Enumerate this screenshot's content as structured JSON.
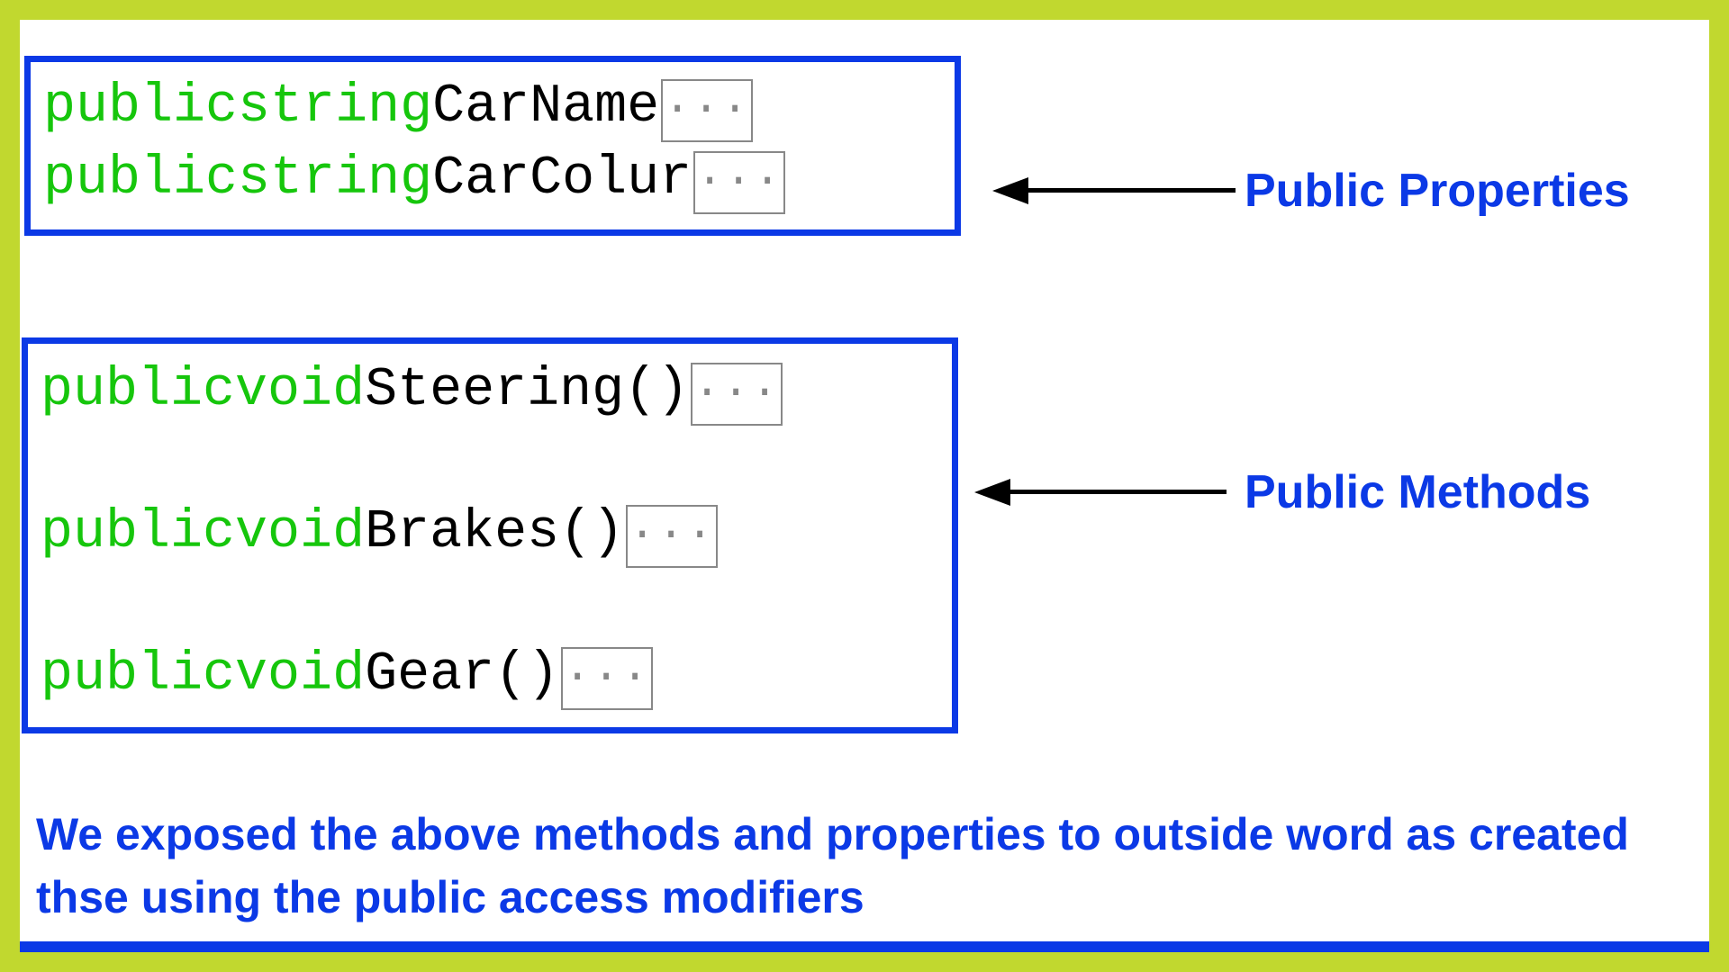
{
  "properties_box": {
    "lines": [
      {
        "modifier": "public ",
        "type": "string ",
        "name": "CarName"
      },
      {
        "modifier": "public ",
        "type": "string ",
        "name": "CarColur"
      }
    ]
  },
  "methods_box": {
    "lines": [
      {
        "modifier": "public ",
        "type": "void ",
        "name": "Steering()"
      },
      {
        "modifier": "public ",
        "type": "void ",
        "name": "Brakes()"
      },
      {
        "modifier": "public ",
        "type": "void ",
        "name": "Gear()"
      }
    ]
  },
  "labels": {
    "properties": "Public Properties",
    "methods": "Public Methods"
  },
  "collapse": "...",
  "footer": "We exposed the above methods and properties to outside word as created thse using the public access modifiers"
}
